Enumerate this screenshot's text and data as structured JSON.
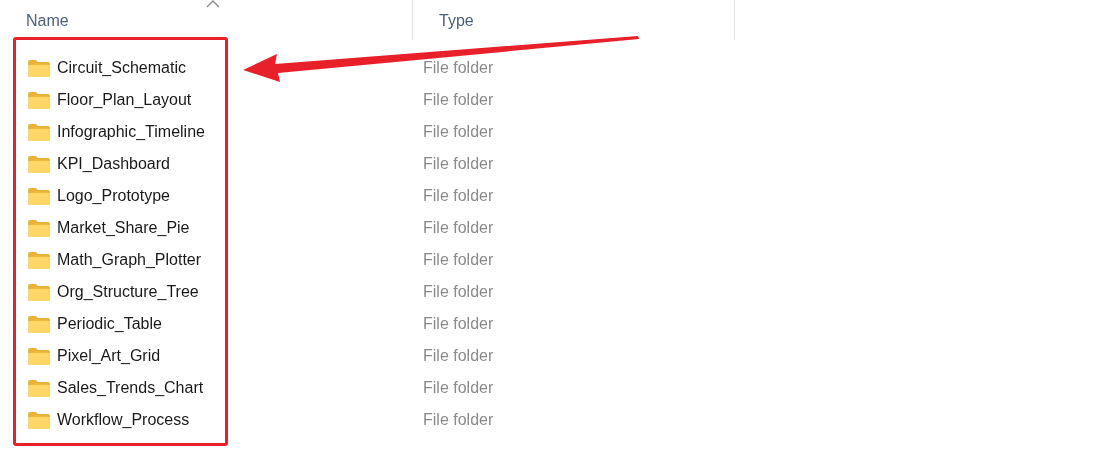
{
  "columns": [
    {
      "label": "Name",
      "sorted": true
    },
    {
      "label": "Type",
      "sorted": false
    }
  ],
  "rows": [
    {
      "name": "Circuit_Schematic",
      "type": "File folder"
    },
    {
      "name": "Floor_Plan_Layout",
      "type": "File folder"
    },
    {
      "name": "Infographic_Timeline",
      "type": "File folder"
    },
    {
      "name": "KPI_Dashboard",
      "type": "File folder"
    },
    {
      "name": "Logo_Prototype",
      "type": "File folder"
    },
    {
      "name": "Market_Share_Pie",
      "type": "File folder"
    },
    {
      "name": "Math_Graph_Plotter",
      "type": "File folder"
    },
    {
      "name": "Org_Structure_Tree",
      "type": "File folder"
    },
    {
      "name": "Periodic_Table",
      "type": "File folder"
    },
    {
      "name": "Pixel_Art_Grid",
      "type": "File folder"
    },
    {
      "name": "Sales_Trends_Chart",
      "type": "File folder"
    },
    {
      "name": "Workflow_Process",
      "type": "File folder"
    }
  ]
}
